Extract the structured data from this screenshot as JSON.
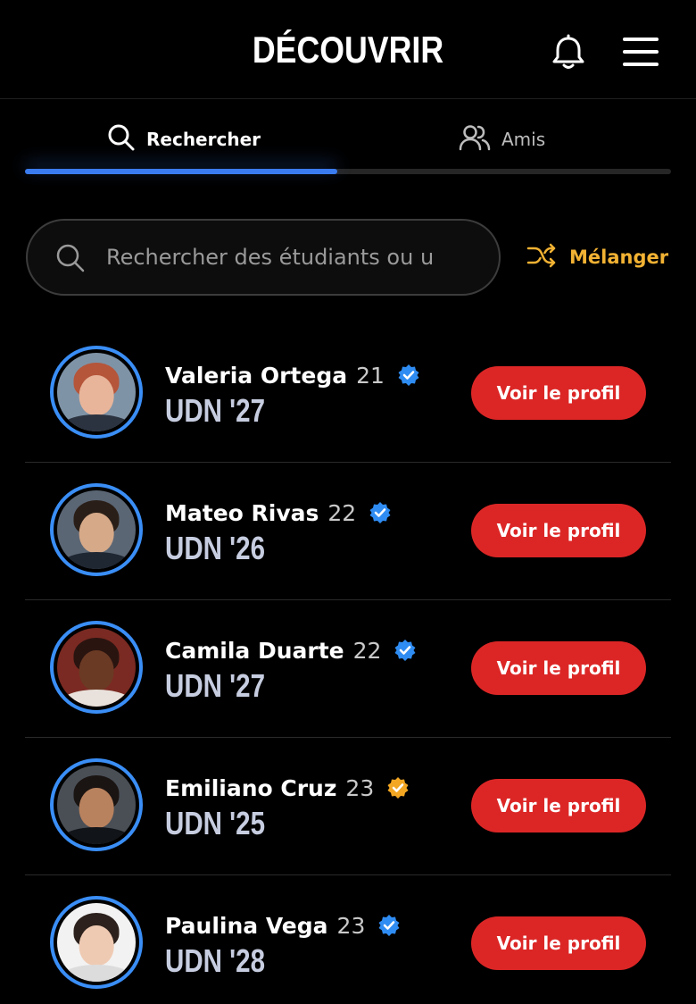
{
  "header": {
    "title": "DÉCOUVRIR",
    "bell_icon": "bell-icon",
    "menu_icon": "hamburger-menu-icon"
  },
  "tabs": [
    {
      "label": "Rechercher",
      "icon": "search-icon",
      "active": true
    },
    {
      "label": "Amis",
      "icon": "users-icon",
      "active": false
    }
  ],
  "search": {
    "placeholder": "Rechercher des étudiants ou u",
    "value": ""
  },
  "shuffle": {
    "label": "Mélanger",
    "icon": "shuffle-icon"
  },
  "colors": {
    "background": "#000000",
    "accent_blue": "#3a7bf0",
    "button_red": "#dc2626",
    "shuffle_orange": "#f2b233",
    "badge_blue": "#2f8cf2",
    "badge_gold": "#f2a622"
  },
  "students": [
    {
      "name": "Valeria Ortega",
      "age": "21",
      "school": "UDN '27",
      "badge": "blue",
      "button": "Voir le profil",
      "skin": "#e8b59a",
      "hair": "#b5553a",
      "bg": "#7f93a6",
      "top": "#2b3340"
    },
    {
      "name": "Mateo Rivas",
      "age": "22",
      "school": "UDN '26",
      "badge": "blue",
      "button": "Voir le profil",
      "skin": "#d6a988",
      "hair": "#2a1f18",
      "bg": "#5b6674",
      "top": "#1f2733"
    },
    {
      "name": "Camila Duarte",
      "age": "22",
      "school": "UDN '27",
      "badge": "blue",
      "button": "Voir le profil",
      "skin": "#6b3a24",
      "hair": "#2a1410",
      "bg": "#7a2a22",
      "top": "#e9e2dc"
    },
    {
      "name": "Emiliano Cruz",
      "age": "23",
      "school": "UDN '25",
      "badge": "gold",
      "button": "Voir le profil",
      "skin": "#b9825e",
      "hair": "#1a1412",
      "bg": "#4a4f56",
      "top": "#111418"
    },
    {
      "name": "Paulina Vega",
      "age": "23",
      "school": "UDN '28",
      "badge": "blue",
      "button": "Voir le profil",
      "skin": "#efcab3",
      "hair": "#2c211c",
      "bg": "#f2f2f2",
      "top": "#dcdcdc"
    }
  ]
}
